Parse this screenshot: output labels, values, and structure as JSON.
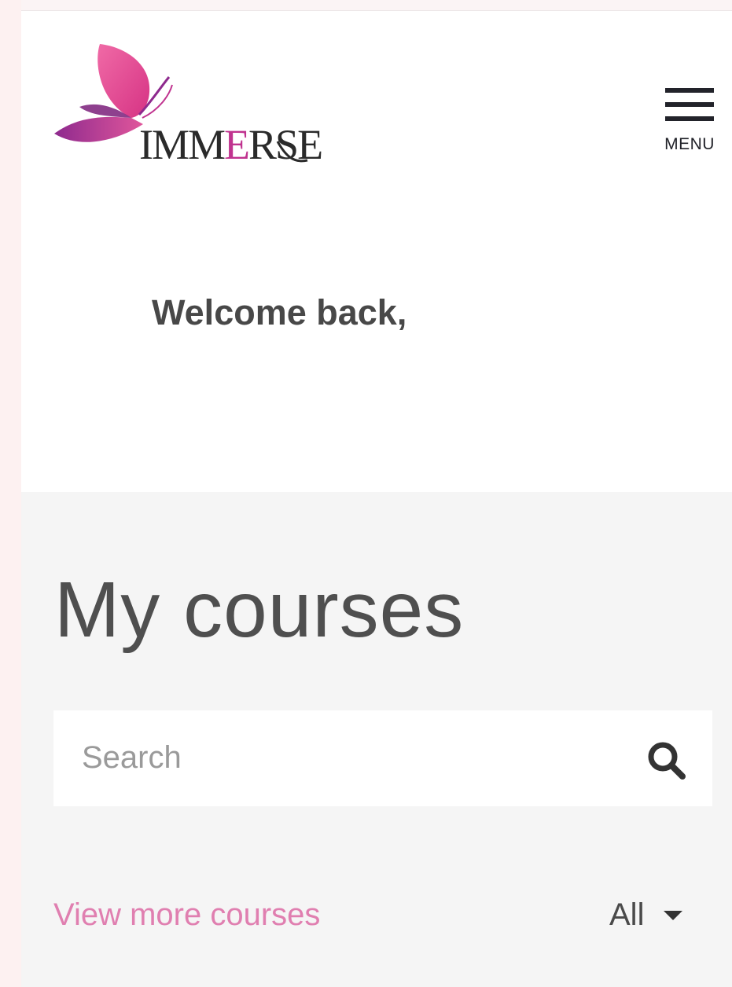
{
  "header": {
    "logo_text": "IMMERSE",
    "menu_label": "MENU"
  },
  "welcome": {
    "greeting": "Welcome back,"
  },
  "courses": {
    "title": "My courses",
    "search": {
      "placeholder": "Search",
      "value": "",
      "icon": "search-icon"
    },
    "view_more_label": "View more courses",
    "filter_label": "All",
    "filter_icon": "caret-down-icon"
  },
  "colors": {
    "accent_pink": "#e07fb0",
    "logo_magenta": "#c0338f",
    "page_background": "#f5f5f5",
    "text_dark": "#4f4f4f"
  }
}
